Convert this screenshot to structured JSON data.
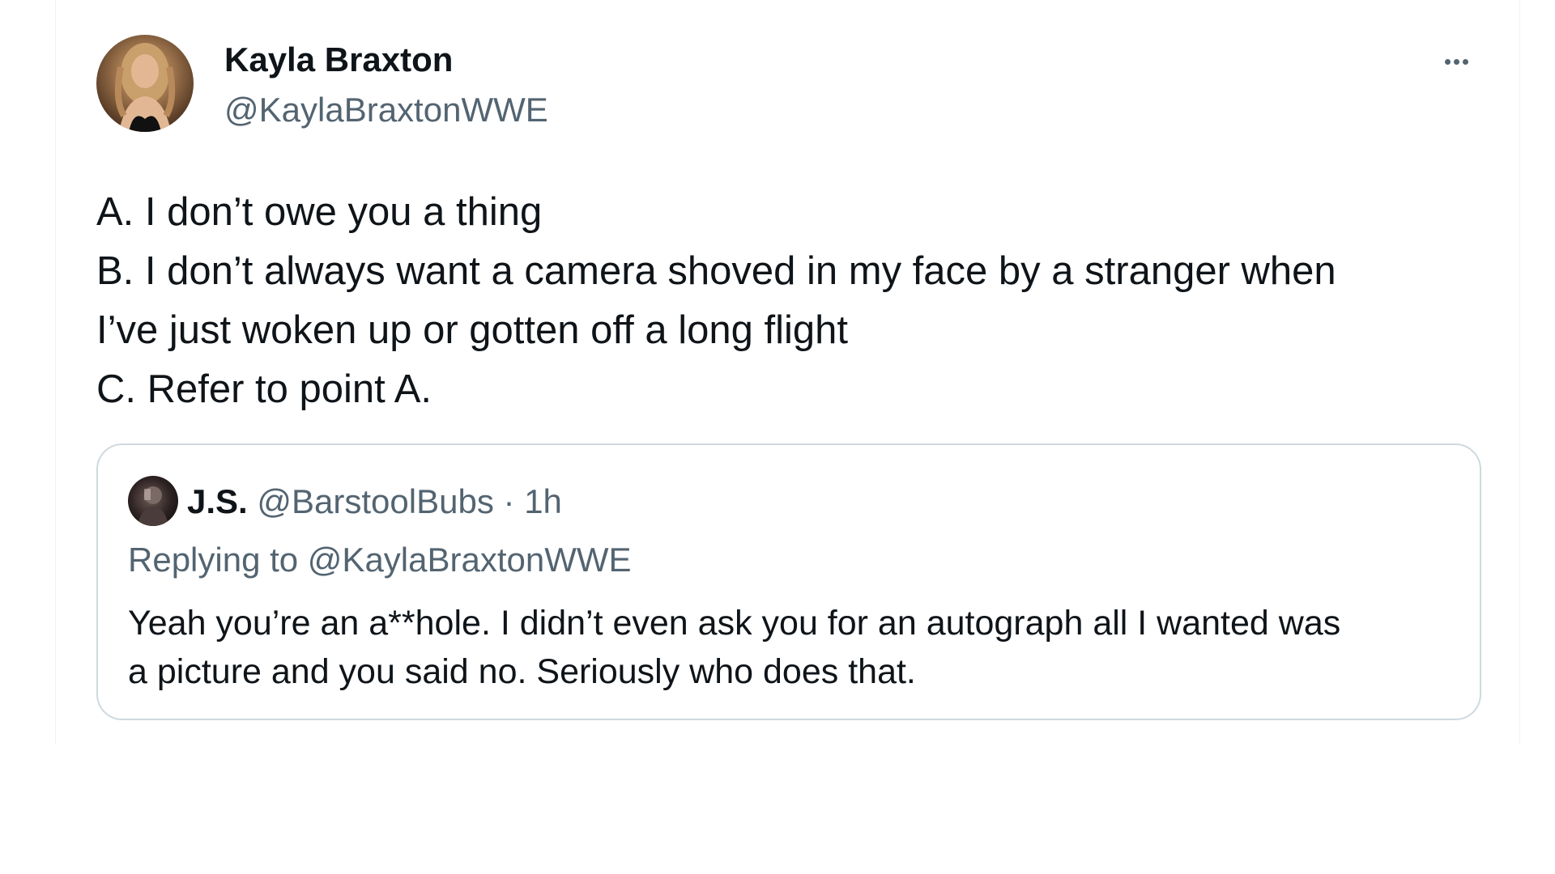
{
  "tweet": {
    "author_name": "Kayla Braxton",
    "author_handle": "@KaylaBraxtonWWE",
    "avatar_icon": "profile-photo",
    "more_icon": "more-horizontal-icon",
    "text_lines": [
      "A. I don’t owe you a thing",
      "B. I don’t always want a camera shoved in my face by a stranger when",
      "I’ve just woken up or gotten off a long flight",
      "C. Refer to point A."
    ]
  },
  "quoted_tweet": {
    "author_name": "J.S.",
    "author_handle": "@BarstoolBubs",
    "separator": "·",
    "time": "1h",
    "replying_to": "Replying to @KaylaBraxtonWWE",
    "text_lines": [
      "Yeah you’re an a**hole. I didn’t even ask you for an autograph all I wanted was",
      "a picture and you said no. Seriously who does that."
    ]
  },
  "colors": {
    "primary_text": "#0f1419",
    "secondary_text": "#536471",
    "border": "#cfd9de"
  }
}
